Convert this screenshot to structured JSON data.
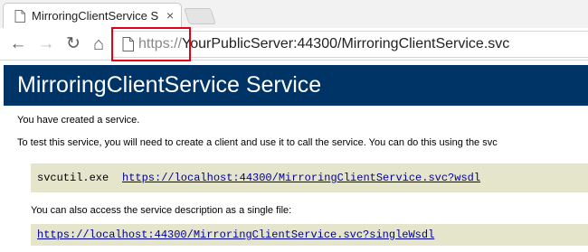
{
  "browser": {
    "tab_title": "MirroringClientService Ser",
    "tab_close": "×",
    "back_glyph": "←",
    "forward_glyph": "→",
    "reload_glyph": "↻",
    "home_glyph": "⌂",
    "url_scheme": "https://",
    "url_rest": "YourPublicServer:44300/MirroringClientService.svc"
  },
  "page": {
    "heading": "MirroringClientService Service",
    "created_text": "You have created a service.",
    "test_text": "To test this service, you will need to create a client and use it to call the service. You can do this using the svc",
    "svcutil_command": "svcutil.exe",
    "wsdl_link": "https://localhost:44300/MirroringClientService.svc?wsdl",
    "single_file_text": "You can also access the service description as a single file:",
    "single_wsdl_link": "https://localhost:44300/MirroringClientService.svc?singleWsdl"
  },
  "colors": {
    "banner": "#003366",
    "code_background": "#e5e5cc",
    "link": "#000099",
    "highlight": "#e3001b"
  }
}
